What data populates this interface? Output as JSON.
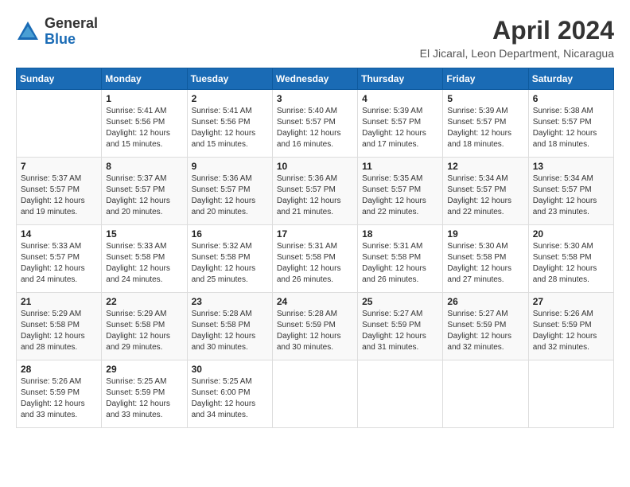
{
  "header": {
    "logo_general": "General",
    "logo_blue": "Blue",
    "month_year": "April 2024",
    "location": "El Jicaral, Leon Department, Nicaragua"
  },
  "days_of_week": [
    "Sunday",
    "Monday",
    "Tuesday",
    "Wednesday",
    "Thursday",
    "Friday",
    "Saturday"
  ],
  "weeks": [
    [
      {
        "day": "",
        "sunrise": "",
        "sunset": "",
        "daylight": ""
      },
      {
        "day": "1",
        "sunrise": "Sunrise: 5:41 AM",
        "sunset": "Sunset: 5:56 PM",
        "daylight": "Daylight: 12 hours and 15 minutes."
      },
      {
        "day": "2",
        "sunrise": "Sunrise: 5:41 AM",
        "sunset": "Sunset: 5:56 PM",
        "daylight": "Daylight: 12 hours and 15 minutes."
      },
      {
        "day": "3",
        "sunrise": "Sunrise: 5:40 AM",
        "sunset": "Sunset: 5:57 PM",
        "daylight": "Daylight: 12 hours and 16 minutes."
      },
      {
        "day": "4",
        "sunrise": "Sunrise: 5:39 AM",
        "sunset": "Sunset: 5:57 PM",
        "daylight": "Daylight: 12 hours and 17 minutes."
      },
      {
        "day": "5",
        "sunrise": "Sunrise: 5:39 AM",
        "sunset": "Sunset: 5:57 PM",
        "daylight": "Daylight: 12 hours and 18 minutes."
      },
      {
        "day": "6",
        "sunrise": "Sunrise: 5:38 AM",
        "sunset": "Sunset: 5:57 PM",
        "daylight": "Daylight: 12 hours and 18 minutes."
      }
    ],
    [
      {
        "day": "7",
        "sunrise": "Sunrise: 5:37 AM",
        "sunset": "Sunset: 5:57 PM",
        "daylight": "Daylight: 12 hours and 19 minutes."
      },
      {
        "day": "8",
        "sunrise": "Sunrise: 5:37 AM",
        "sunset": "Sunset: 5:57 PM",
        "daylight": "Daylight: 12 hours and 20 minutes."
      },
      {
        "day": "9",
        "sunrise": "Sunrise: 5:36 AM",
        "sunset": "Sunset: 5:57 PM",
        "daylight": "Daylight: 12 hours and 20 minutes."
      },
      {
        "day": "10",
        "sunrise": "Sunrise: 5:36 AM",
        "sunset": "Sunset: 5:57 PM",
        "daylight": "Daylight: 12 hours and 21 minutes."
      },
      {
        "day": "11",
        "sunrise": "Sunrise: 5:35 AM",
        "sunset": "Sunset: 5:57 PM",
        "daylight": "Daylight: 12 hours and 22 minutes."
      },
      {
        "day": "12",
        "sunrise": "Sunrise: 5:34 AM",
        "sunset": "Sunset: 5:57 PM",
        "daylight": "Daylight: 12 hours and 22 minutes."
      },
      {
        "day": "13",
        "sunrise": "Sunrise: 5:34 AM",
        "sunset": "Sunset: 5:57 PM",
        "daylight": "Daylight: 12 hours and 23 minutes."
      }
    ],
    [
      {
        "day": "14",
        "sunrise": "Sunrise: 5:33 AM",
        "sunset": "Sunset: 5:57 PM",
        "daylight": "Daylight: 12 hours and 24 minutes."
      },
      {
        "day": "15",
        "sunrise": "Sunrise: 5:33 AM",
        "sunset": "Sunset: 5:58 PM",
        "daylight": "Daylight: 12 hours and 24 minutes."
      },
      {
        "day": "16",
        "sunrise": "Sunrise: 5:32 AM",
        "sunset": "Sunset: 5:58 PM",
        "daylight": "Daylight: 12 hours and 25 minutes."
      },
      {
        "day": "17",
        "sunrise": "Sunrise: 5:31 AM",
        "sunset": "Sunset: 5:58 PM",
        "daylight": "Daylight: 12 hours and 26 minutes."
      },
      {
        "day": "18",
        "sunrise": "Sunrise: 5:31 AM",
        "sunset": "Sunset: 5:58 PM",
        "daylight": "Daylight: 12 hours and 26 minutes."
      },
      {
        "day": "19",
        "sunrise": "Sunrise: 5:30 AM",
        "sunset": "Sunset: 5:58 PM",
        "daylight": "Daylight: 12 hours and 27 minutes."
      },
      {
        "day": "20",
        "sunrise": "Sunrise: 5:30 AM",
        "sunset": "Sunset: 5:58 PM",
        "daylight": "Daylight: 12 hours and 28 minutes."
      }
    ],
    [
      {
        "day": "21",
        "sunrise": "Sunrise: 5:29 AM",
        "sunset": "Sunset: 5:58 PM",
        "daylight": "Daylight: 12 hours and 28 minutes."
      },
      {
        "day": "22",
        "sunrise": "Sunrise: 5:29 AM",
        "sunset": "Sunset: 5:58 PM",
        "daylight": "Daylight: 12 hours and 29 minutes."
      },
      {
        "day": "23",
        "sunrise": "Sunrise: 5:28 AM",
        "sunset": "Sunset: 5:58 PM",
        "daylight": "Daylight: 12 hours and 30 minutes."
      },
      {
        "day": "24",
        "sunrise": "Sunrise: 5:28 AM",
        "sunset": "Sunset: 5:59 PM",
        "daylight": "Daylight: 12 hours and 30 minutes."
      },
      {
        "day": "25",
        "sunrise": "Sunrise: 5:27 AM",
        "sunset": "Sunset: 5:59 PM",
        "daylight": "Daylight: 12 hours and 31 minutes."
      },
      {
        "day": "26",
        "sunrise": "Sunrise: 5:27 AM",
        "sunset": "Sunset: 5:59 PM",
        "daylight": "Daylight: 12 hours and 32 minutes."
      },
      {
        "day": "27",
        "sunrise": "Sunrise: 5:26 AM",
        "sunset": "Sunset: 5:59 PM",
        "daylight": "Daylight: 12 hours and 32 minutes."
      }
    ],
    [
      {
        "day": "28",
        "sunrise": "Sunrise: 5:26 AM",
        "sunset": "Sunset: 5:59 PM",
        "daylight": "Daylight: 12 hours and 33 minutes."
      },
      {
        "day": "29",
        "sunrise": "Sunrise: 5:25 AM",
        "sunset": "Sunset: 5:59 PM",
        "daylight": "Daylight: 12 hours and 33 minutes."
      },
      {
        "day": "30",
        "sunrise": "Sunrise: 5:25 AM",
        "sunset": "Sunset: 6:00 PM",
        "daylight": "Daylight: 12 hours and 34 minutes."
      },
      {
        "day": "",
        "sunrise": "",
        "sunset": "",
        "daylight": ""
      },
      {
        "day": "",
        "sunrise": "",
        "sunset": "",
        "daylight": ""
      },
      {
        "day": "",
        "sunrise": "",
        "sunset": "",
        "daylight": ""
      },
      {
        "day": "",
        "sunrise": "",
        "sunset": "",
        "daylight": ""
      }
    ]
  ]
}
